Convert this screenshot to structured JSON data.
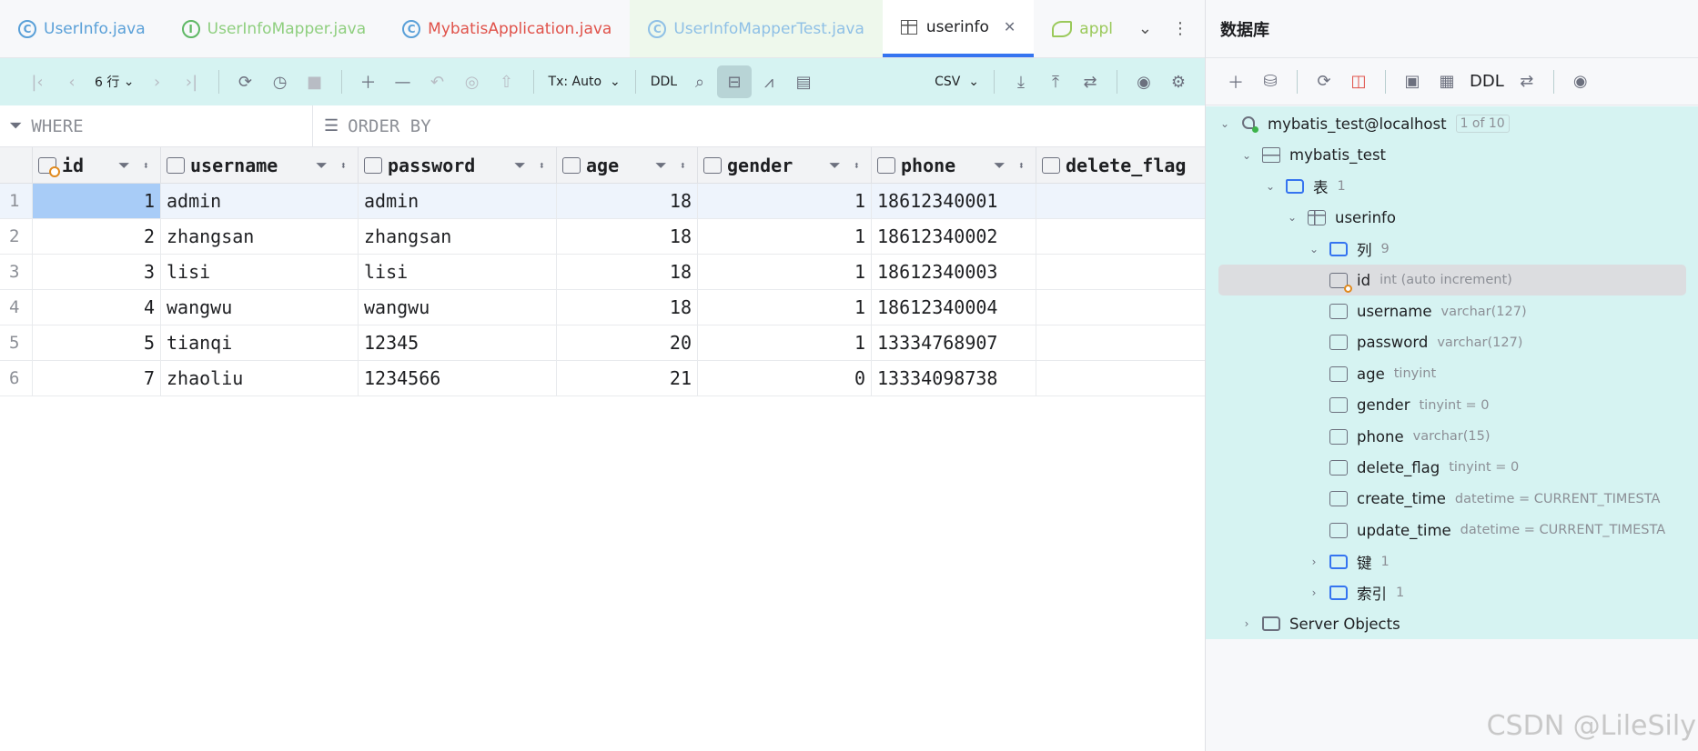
{
  "tabs": [
    {
      "label": "UserInfo.java",
      "icon": "class-icon",
      "color": "#5aa0d8"
    },
    {
      "label": "UserInfoMapper.java",
      "icon": "interface-icon",
      "color": "#5fb865"
    },
    {
      "label": "MybatisApplication.java",
      "icon": "spring-class-icon",
      "color": "#e0524a"
    },
    {
      "label": "UserInfoMapperTest.java",
      "icon": "test-class-icon",
      "color": "#5aa0d8"
    },
    {
      "label": "userinfo",
      "icon": "table-icon",
      "color": "#1e1f22"
    },
    {
      "label": "appl",
      "icon": "spring-config-icon",
      "color": "#9ac95a"
    }
  ],
  "toolbar": {
    "rows_label": "6 行",
    "tx_label": "Tx: Auto",
    "ddl_label": "DDL",
    "csv_label": "CSV"
  },
  "filter": {
    "where": "WHERE",
    "order_by": "ORDER BY"
  },
  "grid": {
    "columns": [
      "id",
      "username",
      "password",
      "age",
      "gender",
      "phone",
      "delete_flag"
    ],
    "rows": [
      {
        "rn": "1",
        "id": "1",
        "username": "admin",
        "password": "admin",
        "age": "18",
        "gender": "1",
        "phone": "18612340001"
      },
      {
        "rn": "2",
        "id": "2",
        "username": "zhangsan",
        "password": "zhangsan",
        "age": "18",
        "gender": "1",
        "phone": "18612340002"
      },
      {
        "rn": "3",
        "id": "3",
        "username": "lisi",
        "password": "lisi",
        "age": "18",
        "gender": "1",
        "phone": "18612340003"
      },
      {
        "rn": "4",
        "id": "4",
        "username": "wangwu",
        "password": "wangwu",
        "age": "18",
        "gender": "1",
        "phone": "18612340004"
      },
      {
        "rn": "5",
        "id": "5",
        "username": "tianqi",
        "password": "12345",
        "age": "20",
        "gender": "1",
        "phone": "13334768907"
      },
      {
        "rn": "6",
        "id": "7",
        "username": "zhaoliu",
        "password": "1234566",
        "age": "21",
        "gender": "0",
        "phone": "13334098738"
      }
    ]
  },
  "db": {
    "title": "数据库",
    "ddl_label": "DDL",
    "datasource": "mybatis_test@localhost",
    "datasource_badge": "1 of 10",
    "schema": "mybatis_test",
    "tables_folder": "表",
    "tables_count": "1",
    "table": "userinfo",
    "columns_folder": "列",
    "columns_count": "9",
    "columns": [
      {
        "name": "id",
        "type": "int (auto increment)"
      },
      {
        "name": "username",
        "type": "varchar(127)"
      },
      {
        "name": "password",
        "type": "varchar(127)"
      },
      {
        "name": "age",
        "type": "tinyint"
      },
      {
        "name": "gender",
        "type": "tinyint = 0"
      },
      {
        "name": "phone",
        "type": "varchar(15)"
      },
      {
        "name": "delete_flag",
        "type": "tinyint = 0"
      },
      {
        "name": "create_time",
        "type": "datetime = CURRENT_TIMESTA"
      },
      {
        "name": "update_time",
        "type": "datetime = CURRENT_TIMESTA"
      }
    ],
    "keys_folder": "键",
    "keys_count": "1",
    "indexes_folder": "索引",
    "indexes_count": "1",
    "server_objects": "Server Objects"
  },
  "watermark": "CSDN @LileSily"
}
